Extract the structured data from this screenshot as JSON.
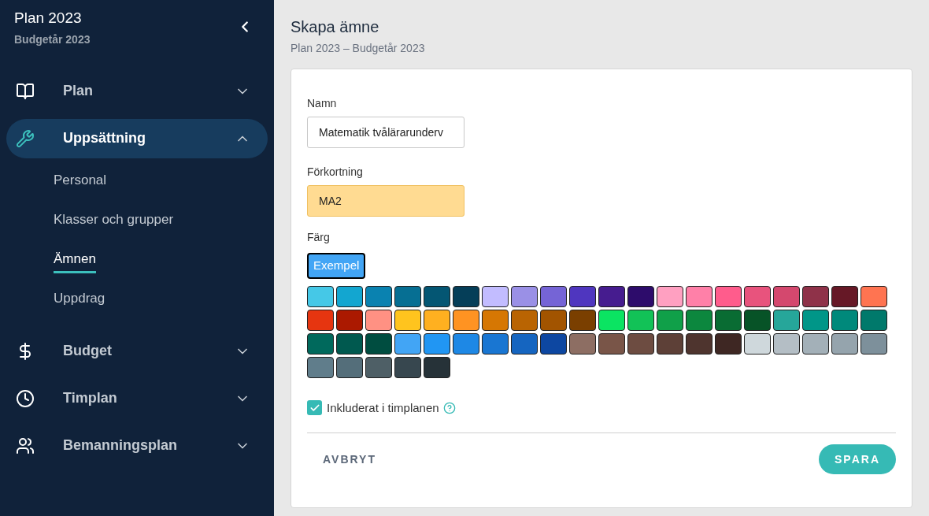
{
  "sidebar": {
    "title": "Plan 2023",
    "subtitle": "Budgetår 2023",
    "items": [
      {
        "label": "Plan",
        "expanded": false,
        "selected": false
      },
      {
        "label": "Uppsättning",
        "expanded": true,
        "selected": true,
        "children": [
          {
            "label": "Personal",
            "selected": false
          },
          {
            "label": "Klasser och grupper",
            "selected": false
          },
          {
            "label": "Ämnen",
            "selected": true
          },
          {
            "label": "Uppdrag",
            "selected": false
          }
        ]
      },
      {
        "label": "Budget",
        "expanded": false,
        "selected": false
      },
      {
        "label": "Timplan",
        "expanded": false,
        "selected": false
      },
      {
        "label": "Bemanningsplan",
        "expanded": false,
        "selected": false
      }
    ]
  },
  "page": {
    "title": "Skapa ämne",
    "subtitle": "Plan 2023 – Budgetår 2023"
  },
  "form": {
    "fields": [
      {
        "label": "Namn",
        "value": "Matematik tvålärarunderv",
        "focused": false
      },
      {
        "label": "Förkortning",
        "value": "MA2",
        "focused": true
      }
    ],
    "color_label": "Färg",
    "preview": {
      "label": "Exempel",
      "color": "#42a5f5"
    },
    "swatches": [
      {
        "color": "#45c8e7"
      },
      {
        "color": "#13a6d0"
      },
      {
        "color": "#0a82b0"
      },
      {
        "color": "#066f93"
      },
      {
        "color": "#045673"
      },
      {
        "color": "#053e58"
      },
      {
        "color": "#c2bcff"
      },
      {
        "color": "#9a90e6"
      },
      {
        "color": "#7564d6"
      },
      {
        "color": "#4f36bf"
      },
      {
        "color": "#461c8f"
      },
      {
        "color": "#2d0c6b"
      },
      {
        "color": "#ffa0c1"
      },
      {
        "color": "#ff80a8"
      },
      {
        "color": "#ff5c8c"
      },
      {
        "color": "#e8537d"
      },
      {
        "color": "#d4486e"
      },
      {
        "color": "#8f3249"
      },
      {
        "color": "#661826"
      },
      {
        "color": "#ff7451"
      },
      {
        "color": "#e63510"
      },
      {
        "color": "#ab1900"
      },
      {
        "color": "#ff9183"
      },
      {
        "color": "#ffc41e"
      },
      {
        "color": "#ffb020"
      },
      {
        "color": "#ff9322"
      },
      {
        "color": "#d67703"
      },
      {
        "color": "#b96402"
      },
      {
        "color": "#a25400"
      },
      {
        "color": "#7a3f00"
      },
      {
        "color": "#0be462"
      },
      {
        "color": "#12c257"
      },
      {
        "color": "#10a049"
      },
      {
        "color": "#0c873e"
      },
      {
        "color": "#096c33"
      },
      {
        "color": "#075327"
      },
      {
        "color": "#26a69a"
      },
      {
        "color": "#009688"
      },
      {
        "color": "#00897b"
      },
      {
        "color": "#00796b"
      },
      {
        "color": "#00695c"
      },
      {
        "color": "#00594f"
      },
      {
        "color": "#004d40"
      },
      {
        "color": "#42a5f5"
      },
      {
        "color": "#2196f3"
      },
      {
        "color": "#1e88e5"
      },
      {
        "color": "#1976d2"
      },
      {
        "color": "#1565c0"
      },
      {
        "color": "#0d47a1"
      },
      {
        "color": "#8d6e63"
      },
      {
        "color": "#795548"
      },
      {
        "color": "#6d4c41"
      },
      {
        "color": "#5d4037"
      },
      {
        "color": "#4e342e"
      },
      {
        "color": "#3e2723"
      },
      {
        "color": "#cfd8dc"
      },
      {
        "color": "#b4bec5"
      },
      {
        "color": "#a3b0b8"
      },
      {
        "color": "#95a4ad"
      },
      {
        "color": "#7d909b"
      },
      {
        "color": "#607d8b"
      },
      {
        "color": "#546e7a"
      },
      {
        "color": "#4e5f66"
      },
      {
        "color": "#37474f"
      },
      {
        "color": "#263238"
      }
    ],
    "checkbox": {
      "label": "Inkluderat i timplanen",
      "checked": true
    },
    "cancel": "AVBRYT",
    "save": "SPARA"
  }
}
